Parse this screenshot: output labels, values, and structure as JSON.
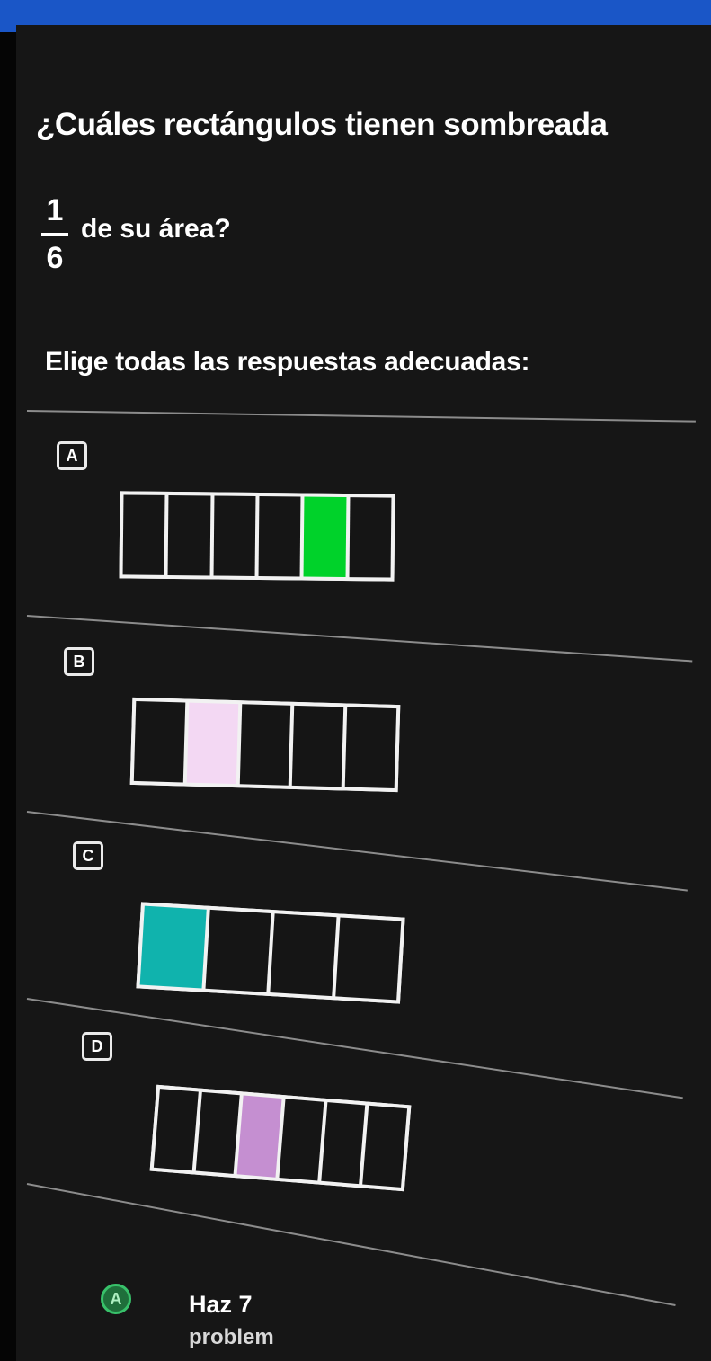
{
  "question": {
    "text": "¿Cuáles rectángulos tienen sombreada",
    "fraction_numerator": "1",
    "fraction_denominator": "6",
    "tail": "de su área?"
  },
  "instruction": "Elige todas las respuestas adecuadas:",
  "options": [
    {
      "letter": "A",
      "cells": 6,
      "shaded_index": 4,
      "shade_color": "#00d22a"
    },
    {
      "letter": "B",
      "cells": 5,
      "shaded_index": 1,
      "shade_color": "#f3d8f3"
    },
    {
      "letter": "C",
      "cells": 4,
      "shaded_index": 0,
      "shade_color": "#10b3ad"
    },
    {
      "letter": "D",
      "cells": 6,
      "shaded_index": 2,
      "shade_color": "#c58fd1"
    }
  ],
  "footer": {
    "icon": "check-circle-icon",
    "icon_glyph": "A",
    "title": "Haz 7",
    "subtitle": "problem"
  },
  "colors": {
    "accent_bar": "#1a56c7",
    "panel": "#161616"
  }
}
